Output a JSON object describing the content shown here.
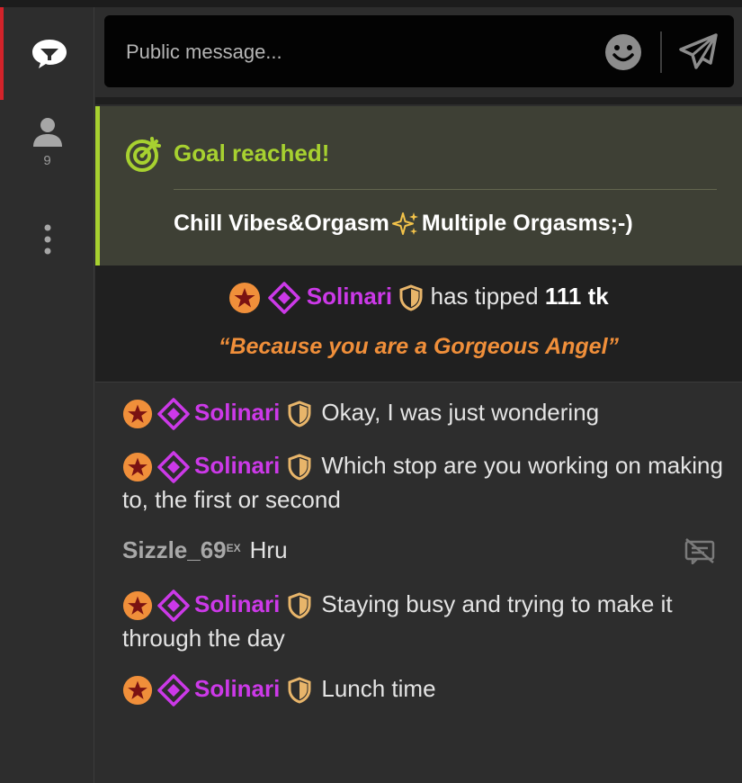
{
  "sidebar": {
    "user_count": "9"
  },
  "composer": {
    "placeholder": "Public message..."
  },
  "goal": {
    "title": "Goal reached!",
    "description_part1": "Chill Vibes&Orgasm",
    "description_part2": "Multiple Orgasms;-)"
  },
  "tip": {
    "username": "Solinari",
    "text": "has tipped",
    "amount": "111 tk",
    "message": "“Because you are a Gorgeous Angel”"
  },
  "messages": [
    {
      "username": "Solinari",
      "text": "Okay, I was just wondering"
    },
    {
      "username": "Solinari",
      "text": "Which stop are you working on making to, the first or second"
    },
    {
      "username": "Sizzle_69",
      "suffix": "EX",
      "text": "Hru"
    },
    {
      "username": "Solinari",
      "text": "Staying busy and trying to make it through the day"
    },
    {
      "username": "Solinari",
      "text": "Lunch time"
    }
  ],
  "colors": {
    "accent_red": "#d2232a",
    "goal_green": "#a7d130",
    "username_purple": "#cc39e8",
    "tip_orange": "#f08f3a",
    "star_badge": "#f08f3a",
    "shield_badge": "#e8b56a"
  },
  "icons": {
    "chat": "chat-bubble-icon",
    "users": "user-icon",
    "more": "more-vertical-icon",
    "emoji": "smiley-icon",
    "send": "paper-plane-icon",
    "goal": "target-icon",
    "sparkles": "sparkles-icon",
    "star": "star-badge-icon",
    "diamond": "diamond-badge-icon",
    "shield": "shield-badge-icon",
    "hide": "hide-message-icon"
  }
}
